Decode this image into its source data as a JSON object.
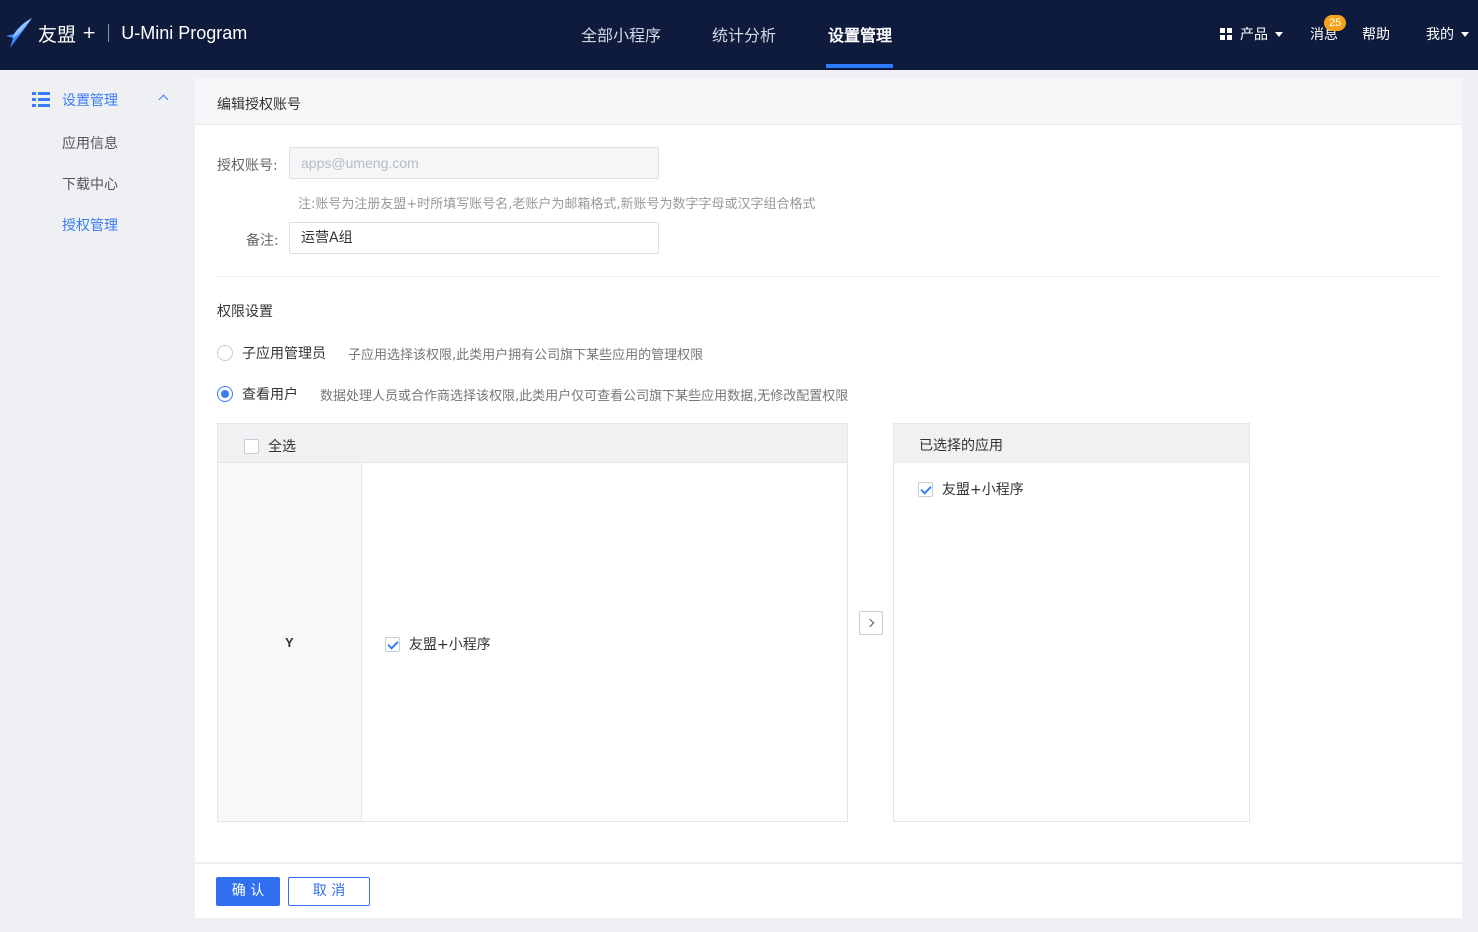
{
  "topbar": {
    "brand_name": "友盟",
    "brand_plus": "+",
    "brand_sub": "U-Mini Program",
    "tabs": [
      {
        "label": "全部小程序",
        "active": false
      },
      {
        "label": "统计分析",
        "active": false
      },
      {
        "label": "设置管理",
        "active": true
      }
    ],
    "products_label": "产品",
    "messages_label": "消息",
    "messages_badge": "25",
    "help_label": "帮助",
    "mine_label": "我的"
  },
  "sidebar": {
    "group_label": "设置管理",
    "items": [
      {
        "label": "应用信息",
        "active": false
      },
      {
        "label": "下载中心",
        "active": false
      },
      {
        "label": "授权管理",
        "active": true
      }
    ]
  },
  "form": {
    "title": "编辑授权账号",
    "account_label": "授权账号:",
    "account_placeholder": "apps@umeng.com",
    "note": "注:账号为注册友盟+时所填写账号名,老账户为邮箱格式,新账号为数字字母或汉字组合格式",
    "remark_label": "备注:",
    "remark_value": "运营A组"
  },
  "permissions": {
    "title": "权限设置",
    "options": [
      {
        "label": "子应用管理员",
        "desc": "子应用选择该权限,此类用户拥有公司旗下某些应用的管理权限",
        "checked": false
      },
      {
        "label": "查看用户",
        "desc": "数据处理人员或合作商选择该权限,此类用户仅可查看公司旗下某些应用数据,无修改配置权限",
        "checked": true
      }
    ]
  },
  "transfer": {
    "select_all_label": "全选",
    "group_label": "Y",
    "available_items": [
      {
        "label": "友盟+小程序",
        "checked": true
      }
    ],
    "selected_title": "已选择的应用",
    "selected_items": [
      {
        "label": "友盟+小程序",
        "checked": true
      }
    ]
  },
  "footer": {
    "confirm_label": "确 认",
    "cancel_label": "取 消"
  },
  "colors": {
    "topbar_bg": "#0f1b3d",
    "accent": "#2f6ff0",
    "badge": "#f7a21b"
  },
  "icons": [
    "brand-bird-icon",
    "grid-icon",
    "caret-down-icon",
    "list-icon",
    "chevron-up-icon",
    "chevron-right-icon"
  ]
}
